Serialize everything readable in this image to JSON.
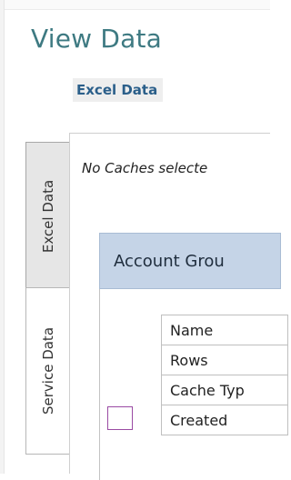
{
  "page": {
    "title": "View Data",
    "subtitle": "Excel Data"
  },
  "tabs": [
    {
      "label": "Excel Data",
      "selected": false
    },
    {
      "label": "Service Data",
      "selected": true
    }
  ],
  "main": {
    "status_text": "No Caches selecte",
    "group": {
      "header": "Account Grou",
      "properties": [
        {
          "name": "Name"
        },
        {
          "name": "Rows"
        },
        {
          "name": "Cache Typ"
        },
        {
          "name": "Created"
        }
      ],
      "checkbox_checked": false
    }
  },
  "colors": {
    "title": "#3e7a82",
    "subtitle": "#2b5f8a",
    "group_header_bg": "#c5d4e7",
    "checkbox_border": "#9a4aa3"
  }
}
